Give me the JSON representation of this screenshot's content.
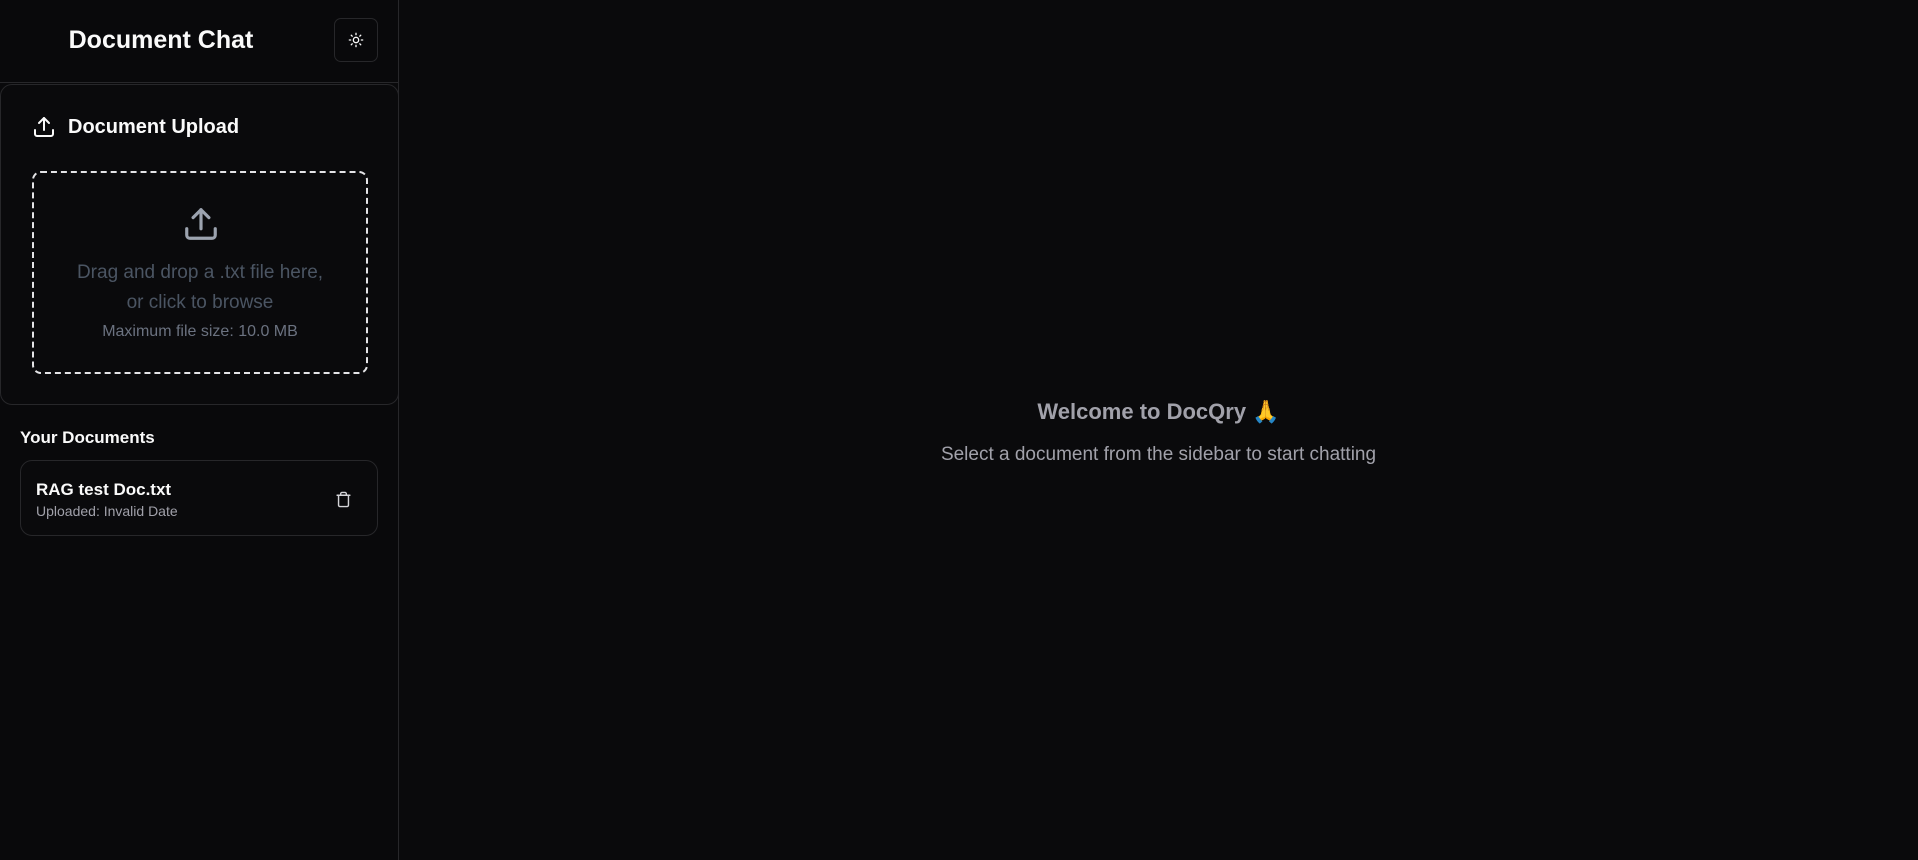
{
  "sidebar": {
    "title": "Document Chat",
    "theme_toggle_icon": "sun-icon",
    "upload": {
      "title": "Document Upload",
      "icon": "upload-icon",
      "dropzone_line1": "Drag and drop a .txt file here,",
      "dropzone_line2": "or click to browse",
      "max_size": "Maximum file size: 10.0 MB"
    },
    "documents": {
      "heading": "Your Documents",
      "items": [
        {
          "name": "RAG test Doc.txt",
          "uploaded": "Uploaded: Invalid Date",
          "action_icon": "trash-icon"
        }
      ]
    }
  },
  "main": {
    "welcome_title": "Welcome to DocQry 🙏",
    "welcome_subtitle": "Select a document from the sidebar to start chatting"
  },
  "colors": {
    "background": "#0a0a0c",
    "border": "#27272a",
    "text": "#fafafa",
    "muted_text": "#a1a1aa"
  }
}
